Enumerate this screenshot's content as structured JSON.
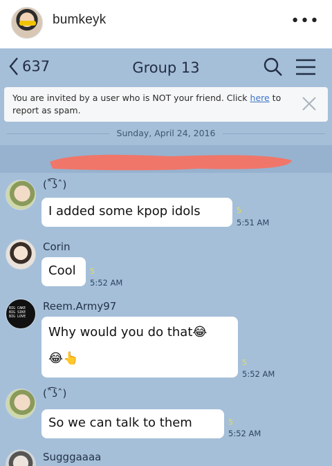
{
  "post": {
    "username": "bumkeyk",
    "more_icon": "more-dots-icon"
  },
  "chat": {
    "back_count": "637",
    "title": "Group 13",
    "icons": [
      "chevron-left-icon",
      "search-icon",
      "menu-icon"
    ],
    "spam_banner": {
      "text_before": "You are invited by a user who is NOT your friend. Click ",
      "link": "here",
      "text_after": " to report as spam."
    },
    "date": "Sunday, April 24, 2016",
    "colors": {
      "background": "#a5bfd9",
      "bubble": "#ffffff",
      "redaction": "#f0766a",
      "read_marker": "#e8e040"
    },
    "messages": [
      {
        "sender": "(ˆ͡ʖˆ)",
        "text": "I added some kpop idols",
        "read": "5",
        "time": "5:51 AM"
      },
      {
        "sender": "Corin",
        "text": "Cool",
        "read": "5",
        "time": "5:52 AM"
      },
      {
        "sender": "Reem.Army97",
        "line1": "Why would you do that",
        "line2_emoji": "😂👆",
        "read": "5",
        "time": "5:52 AM"
      },
      {
        "sender": "(ˆ͡ʖˆ)",
        "text": "So we can talk to them",
        "read": "5",
        "time": "5:52 AM"
      },
      {
        "sender": "Sugggaaaa"
      }
    ]
  }
}
